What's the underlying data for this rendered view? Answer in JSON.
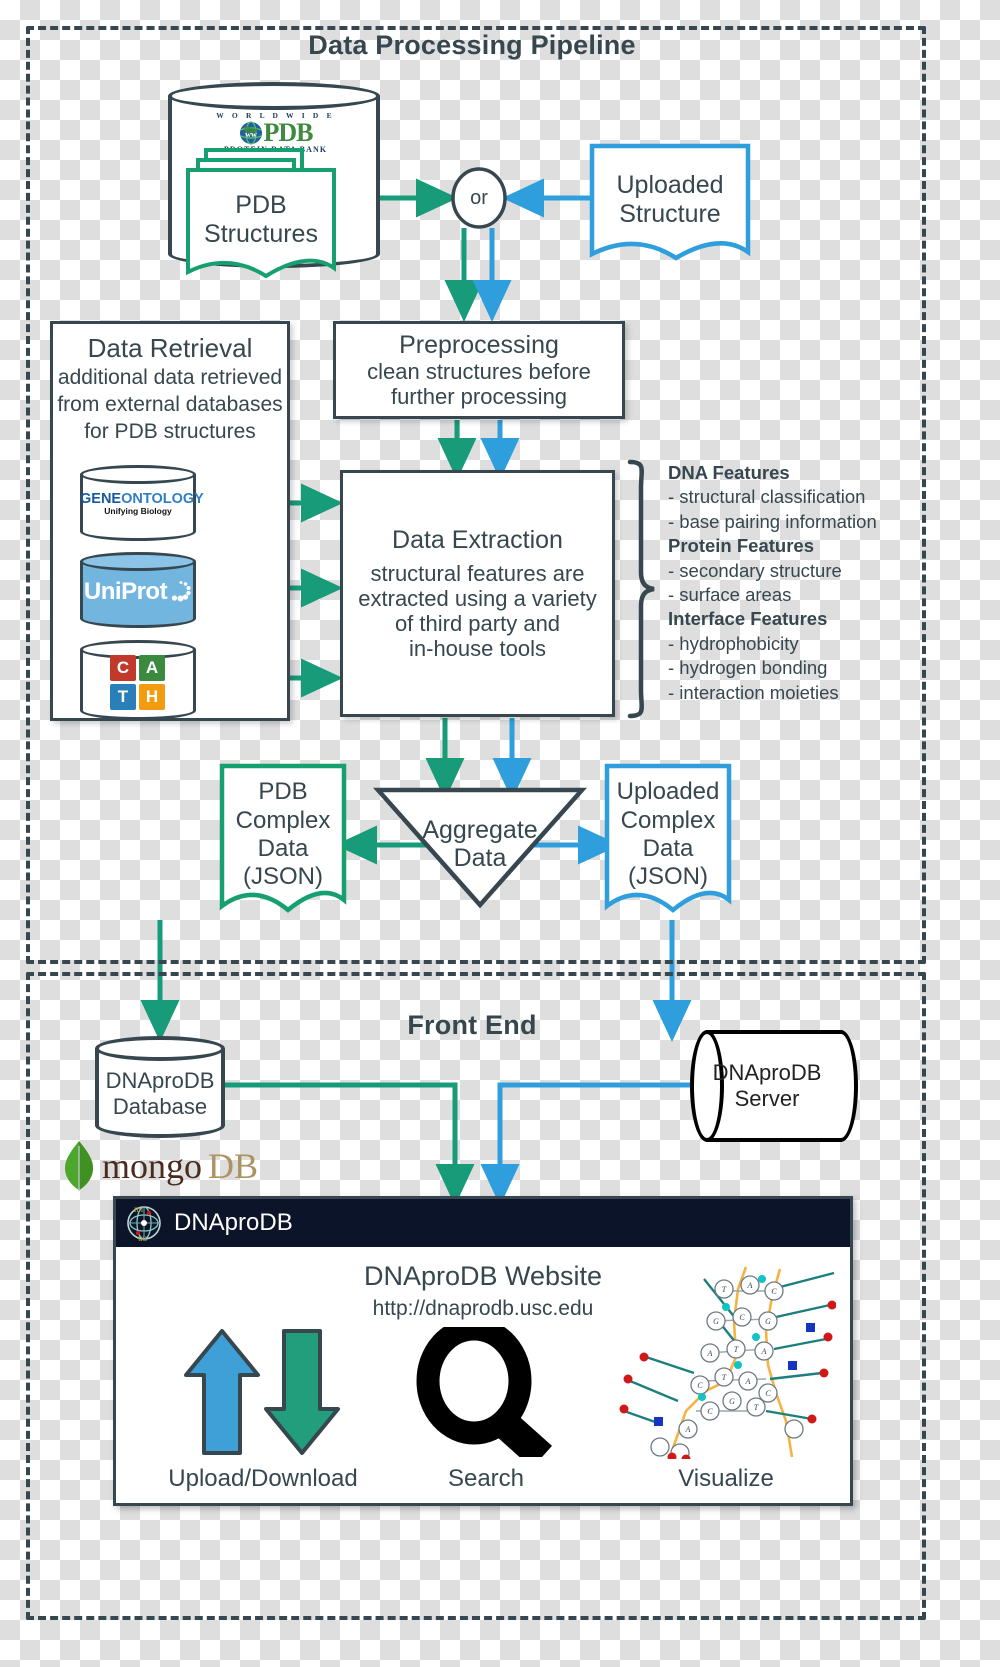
{
  "sections": {
    "pipeline_title": "Data Processing Pipeline",
    "frontend_title": "Front End"
  },
  "colors": {
    "green": "#179b78",
    "blue": "#2e9fdc",
    "dark": "#37474f",
    "navbar": "#0b1428"
  },
  "pdb_store": {
    "logo": {
      "worldwide": "W O R L D W I D E",
      "pdb": "PDB",
      "subtitle": "PROTEIN DATA BANK",
      "globe_text": "ww"
    },
    "banner_line1": "PDB",
    "banner_line2": "Structures"
  },
  "or_gate": {
    "label": "or"
  },
  "uploaded_structure": {
    "line1": "Uploaded",
    "line2": "Structure"
  },
  "preprocessing": {
    "title": "Preprocessing",
    "sub1": "clean structures before",
    "sub2": "further processing"
  },
  "data_retrieval": {
    "title": "Data Retrieval",
    "sub1": "additional data retrieved",
    "sub2": "from external databases",
    "sub3": "for PDB structures",
    "databases": [
      {
        "name": "gene-ontology",
        "text_a": "GENE",
        "text_b": "ONTOLOGY",
        "tagline": "Unifying Biology"
      },
      {
        "name": "uniprot",
        "text": "UniProt"
      },
      {
        "name": "cath",
        "letters": [
          {
            "ch": "C",
            "color": "#c0392b"
          },
          {
            "ch": "A",
            "color": "#3c8a3f"
          },
          {
            "ch": "T",
            "color": "#2980b9"
          },
          {
            "ch": "H",
            "color": "#f39c12"
          }
        ]
      }
    ]
  },
  "data_extraction": {
    "title": "Data Extraction",
    "sub1": "structural features are",
    "sub2": "extracted using a variety",
    "sub3": "of third party and",
    "sub4": "in-house tools"
  },
  "features": [
    {
      "type": "header",
      "text": "DNA Features"
    },
    {
      "type": "item",
      "text": "- structural classification"
    },
    {
      "type": "item",
      "text": "- base pairing information"
    },
    {
      "type": "header",
      "text": "Protein Features"
    },
    {
      "type": "item",
      "text": "- secondary structure"
    },
    {
      "type": "item",
      "text": "- surface areas"
    },
    {
      "type": "header",
      "text": "Interface Features"
    },
    {
      "type": "item",
      "text": "- hydrophobicity"
    },
    {
      "type": "item",
      "text": "- hydrogen bonding"
    },
    {
      "type": "item",
      "text": "- interaction moieties"
    }
  ],
  "aggregate": {
    "line1": "Aggregate",
    "line2": "Data"
  },
  "pdb_complex": {
    "l1": "PDB",
    "l2": "Complex",
    "l3": "Data",
    "l4": "(JSON)"
  },
  "uploaded_complex": {
    "l1": "Uploaded",
    "l2": "Complex",
    "l3": "Data",
    "l4": "(JSON)"
  },
  "database_node": {
    "l1": "DNAproDB",
    "l2": "Database"
  },
  "server_node": {
    "l1": "DNAproDB",
    "l2": "Server"
  },
  "mongodb": {
    "part1": "mongo",
    "part2": "DB"
  },
  "website": {
    "navbar_brand": "DNAproDB",
    "title": "DNAproDB Website",
    "url": "http://dnaprodb.usc.edu",
    "features": [
      {
        "name": "upload-download",
        "label": "Upload/Download"
      },
      {
        "name": "search",
        "label": "Search"
      },
      {
        "name": "visualize",
        "label": "Visualize"
      }
    ]
  }
}
